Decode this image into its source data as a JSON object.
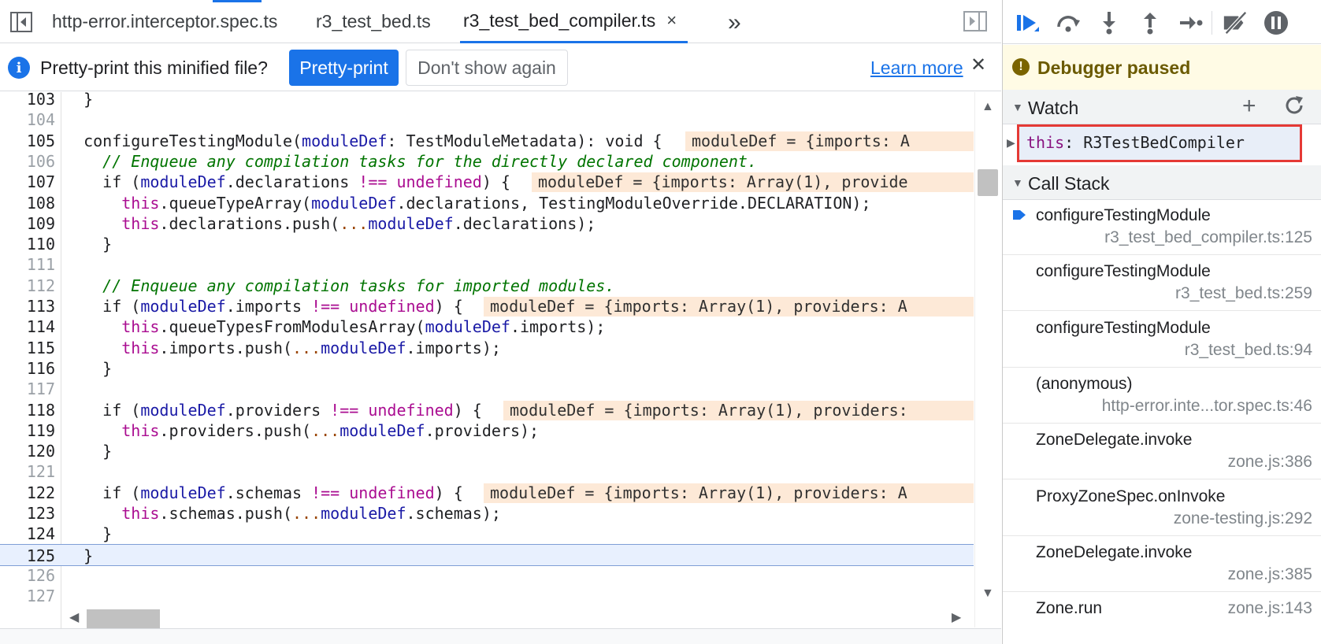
{
  "tabs": [
    {
      "label": "http-error.interceptor.spec.ts",
      "active": false
    },
    {
      "label": "r3_test_bed.ts",
      "active": false
    },
    {
      "label": "r3_test_bed_compiler.ts",
      "active": true
    }
  ],
  "tab_close_glyph": "×",
  "more_tabs_glyph": "»",
  "infobar": {
    "message": "Pretty-print this minified file?",
    "pretty_print_label": "Pretty-print",
    "dont_show_label": "Don't show again",
    "learn_more_label": "Learn more",
    "close_glyph": "✕"
  },
  "code": {
    "lines": [
      {
        "n": "103",
        "text": "  }"
      },
      {
        "n": "104",
        "text": ""
      },
      {
        "n": "105",
        "text": "  configureTestingModule(moduleDef: TestModuleMetadata): void {",
        "hint": "moduleDef = {imports: A"
      },
      {
        "n": "106",
        "text": "    // Enqueue any compilation tasks for the directly declared component."
      },
      {
        "n": "107",
        "text": "    if (moduleDef.declarations !== undefined) {",
        "hint": "moduleDef = {imports: Array(1), provide"
      },
      {
        "n": "108",
        "text": "      this.queueTypeArray(moduleDef.declarations, TestingModuleOverride.DECLARATION);"
      },
      {
        "n": "109",
        "text": "      this.declarations.push(...moduleDef.declarations);"
      },
      {
        "n": "110",
        "text": "    }"
      },
      {
        "n": "111",
        "text": ""
      },
      {
        "n": "112",
        "text": "    // Enqueue any compilation tasks for imported modules."
      },
      {
        "n": "113",
        "text": "    if (moduleDef.imports !== undefined) {",
        "hint": "moduleDef = {imports: Array(1), providers: A"
      },
      {
        "n": "114",
        "text": "      this.queueTypesFromModulesArray(moduleDef.imports);"
      },
      {
        "n": "115",
        "text": "      this.imports.push(...moduleDef.imports);"
      },
      {
        "n": "116",
        "text": "    }"
      },
      {
        "n": "117",
        "text": ""
      },
      {
        "n": "118",
        "text": "    if (moduleDef.providers !== undefined) {",
        "hint": "moduleDef = {imports: Array(1), providers:"
      },
      {
        "n": "119",
        "text": "      this.providers.push(...moduleDef.providers);"
      },
      {
        "n": "120",
        "text": "    }"
      },
      {
        "n": "121",
        "text": ""
      },
      {
        "n": "122",
        "text": "    if (moduleDef.schemas !== undefined) {",
        "hint": "moduleDef = {imports: Array(1), providers: A"
      },
      {
        "n": "123",
        "text": "      this.schemas.push(...moduleDef.schemas);"
      },
      {
        "n": "124",
        "text": "    }"
      },
      {
        "n": "125",
        "text": "  }",
        "current": true
      },
      {
        "n": "126",
        "text": ""
      },
      {
        "n": "127",
        "text": ""
      }
    ],
    "dim_lines": [
      "104",
      "106",
      "111",
      "112",
      "117",
      "121",
      "126",
      "127"
    ]
  },
  "debugger": {
    "paused_text": "Debugger paused",
    "watch_title": "Watch",
    "watch_add_glyph": "+",
    "watch_expression": {
      "name": "this",
      "value": "R3TestBedCompiler"
    },
    "callstack_title": "Call Stack",
    "frames": [
      {
        "name": "configureTestingModule",
        "location": "r3_test_bed_compiler.ts:125",
        "current": true
      },
      {
        "name": "configureTestingModule",
        "location": "r3_test_bed.ts:259"
      },
      {
        "name": "configureTestingModule",
        "location": "r3_test_bed.ts:94"
      },
      {
        "name": "(anonymous)",
        "location": "http-error.inte...tor.spec.ts:46"
      },
      {
        "name": "ZoneDelegate.invoke",
        "location": "zone.js:386"
      },
      {
        "name": "ProxyZoneSpec.onInvoke",
        "location": "zone-testing.js:292"
      },
      {
        "name": "ZoneDelegate.invoke",
        "location": "zone.js:385"
      },
      {
        "name": "Zone.run",
        "location": "zone.js:143",
        "inline": true
      }
    ]
  },
  "colors": {
    "accent": "#1a73e8",
    "paused_banner": "#fffbe5",
    "hint_background": "#fde9d7",
    "watch_highlight_border": "#e53935"
  }
}
